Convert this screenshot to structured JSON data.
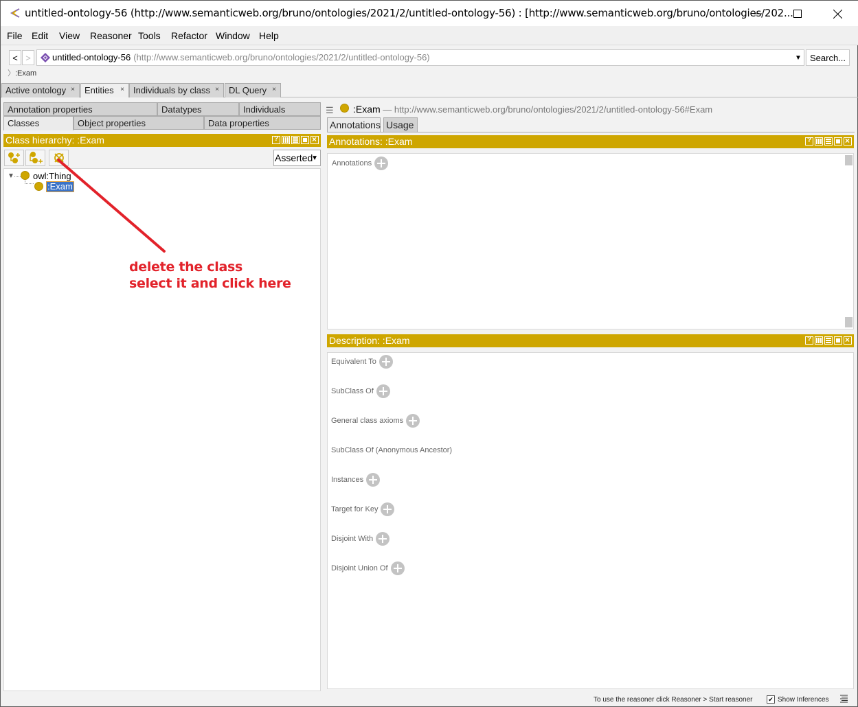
{
  "window": {
    "title": "untitled-ontology-56 (http://www.semanticweb.org/bruno/ontologies/2021/2/untitled-ontology-56)  : [http://www.semanticweb.org/bruno/ontologies/202..."
  },
  "menu": {
    "items": [
      "File",
      "Edit",
      "View",
      "Reasoner",
      "Tools",
      "Refactor",
      "Window",
      "Help"
    ]
  },
  "address": {
    "back_label": "<",
    "forward_label": ">",
    "ontology_name": "untitled-ontology-56",
    "ontology_iri": "(http://www.semanticweb.org/bruno/ontologies/2021/2/untitled-ontology-56)",
    "search_label": "Search...",
    "breadcrumb": ":Exam"
  },
  "main_tabs": [
    {
      "label": "Active ontology",
      "active": false
    },
    {
      "label": "Entities",
      "active": true
    },
    {
      "label": "Individuals by class",
      "active": false
    },
    {
      "label": "DL Query",
      "active": false
    }
  ],
  "tab_close_glyph": "×",
  "entity_tabs": {
    "row1": [
      "Annotation properties",
      "Datatypes",
      "Individuals"
    ],
    "row2": [
      "Classes",
      "Object properties",
      "Data properties"
    ],
    "active": "Classes"
  },
  "class_hierarchy": {
    "header": "Class hierarchy: :Exam",
    "view_mode": "Asserted",
    "tree": [
      {
        "label": "owl:Thing",
        "expanded": true
      },
      {
        "label": ":Exam",
        "selected": true
      }
    ],
    "toolbar": {
      "add_subclass": "add-subclass-icon",
      "add_sibling": "add-sibling-class-icon",
      "delete_class": "delete-class-icon"
    }
  },
  "entity": {
    "name": ":Exam",
    "iri": " — http://www.semanticweb.org/bruno/ontologies/2021/2/untitled-ontology-56#Exam",
    "tabs": [
      {
        "label": "Annotations",
        "active": true
      },
      {
        "label": "Usage",
        "active": false
      }
    ]
  },
  "annotations_view": {
    "header": "Annotations: :Exam",
    "label": "Annotations"
  },
  "description_view": {
    "header": "Description: :Exam",
    "sections": [
      {
        "label": "Equivalent To",
        "addable": true
      },
      {
        "label": "SubClass Of",
        "addable": true
      },
      {
        "label": "General class axioms",
        "addable": true
      },
      {
        "label": "SubClass Of (Anonymous Ancestor)",
        "addable": false
      },
      {
        "label": "Instances",
        "addable": true
      },
      {
        "label": "Target for Key",
        "addable": true
      },
      {
        "label": "Disjoint With",
        "addable": true
      },
      {
        "label": "Disjoint Union Of",
        "addable": true
      }
    ]
  },
  "overlay_annotation": {
    "line1": "delete the class",
    "line2": "select it and click here",
    "color": "#e2222a"
  },
  "status_bar": {
    "message": "To use the reasoner click Reasoner > Start reasoner",
    "show_inferences_label": "Show Inferences",
    "show_inferences_checked": true,
    "check_glyph": "✔"
  },
  "colors": {
    "view_header": "#cea600",
    "class_icon": "#cfa600",
    "selection": "#3b73c7"
  }
}
